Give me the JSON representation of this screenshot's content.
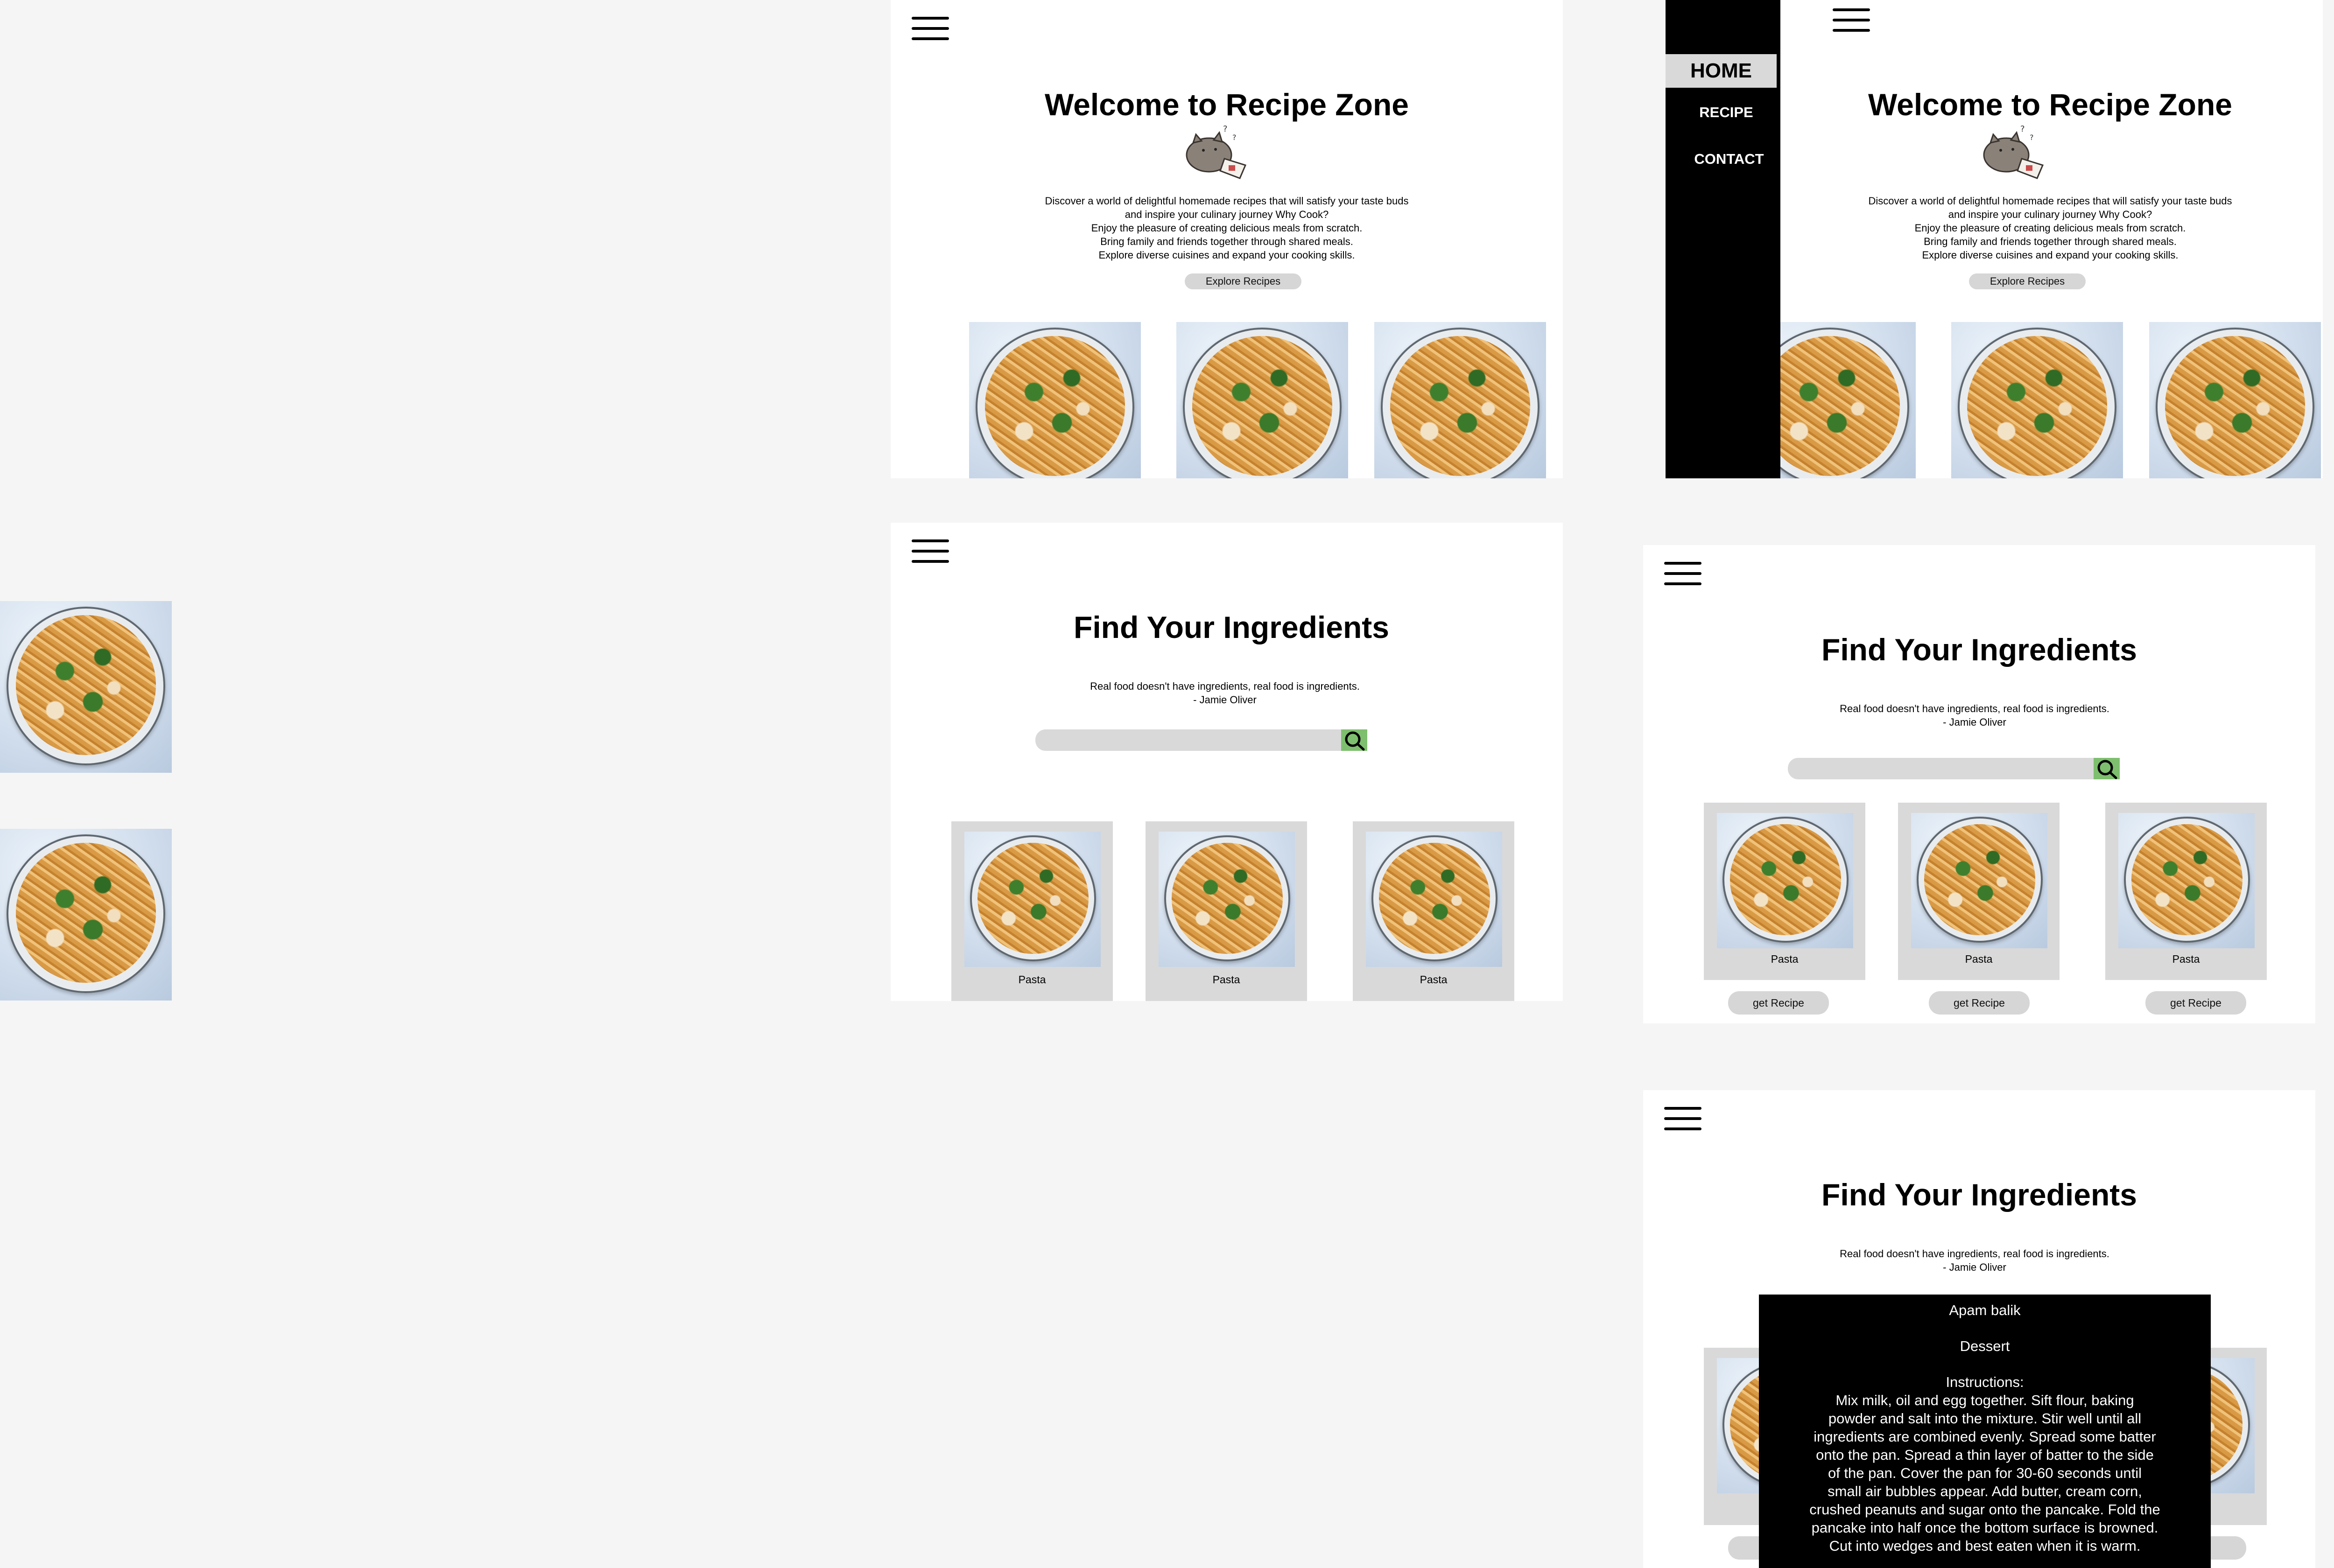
{
  "home": {
    "title": "Welcome to Recipe Zone",
    "paragraphs": [
      "Discover a world of delightful homemade recipes that will satisfy your taste buds",
      "and inspire your culinary journey Why Cook?",
      "Enjoy the pleasure of creating delicious meals from scratch.",
      "Bring family and friends together through shared meals.",
      "Explore diverse cuisines and expand your cooking skills."
    ],
    "explore_label": "Explore Recipes"
  },
  "nav": {
    "items": [
      {
        "label": "HOME",
        "active": true
      },
      {
        "label": "RECIPE",
        "active": false
      },
      {
        "label": "CONTACT",
        "active": false
      }
    ]
  },
  "finder": {
    "title": "Find Your Ingredients",
    "quote": "Real food doesn't have ingredients, real food is ingredients.",
    "author": "- Jamie Oliver",
    "search_placeholder": "",
    "card_label": "Pasta",
    "get_recipe_label": "get Recipe"
  },
  "detail": {
    "name": "Apam balik",
    "category": "Dessert",
    "instructions_label": "Instructions:",
    "instructions_lines": [
      "Mix milk, oil and egg together. Sift flour, baking",
      "powder and salt into the mixture. Stir well until all",
      "ingredients are combined evenly. Spread some batter",
      "onto the pan. Spread a thin layer of batter to the side",
      "of the pan. Cover the pan for 30-60 seconds until",
      "small air bubbles appear. Add butter, cream corn,",
      "crushed peanuts and sugar onto the pancake. Fold the",
      "pancake into half once the bottom surface is browned.",
      "Cut into wedges and best eaten when it is warm."
    ]
  },
  "colors": {
    "canvas": "#f5f5f5",
    "frame": "#ffffff",
    "sidebar": "#000000",
    "active_nav_bg": "#d9d9d9",
    "card_bg": "#d9d9d9",
    "button_bg": "#d6d6d6",
    "search_button": "#7dbf6e",
    "modal_bg": "#000000"
  },
  "icons": [
    "hamburger-menu-icon",
    "search-icon",
    "cat-mascot-icon"
  ]
}
